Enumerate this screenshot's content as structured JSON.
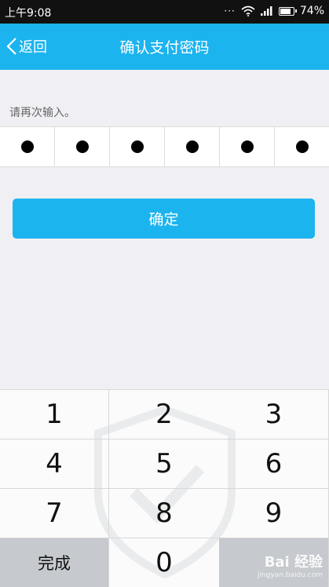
{
  "status_bar": {
    "time": "上午9:08",
    "dots": "···",
    "battery_text": "74%",
    "battery_level": 0.74
  },
  "nav": {
    "back_label": "返回",
    "title": "确认支付密码"
  },
  "hint": "请再次输入。",
  "pin": {
    "filled_count": 6
  },
  "confirm_label": "确定",
  "keypad": {
    "keys": [
      "1",
      "2",
      "3",
      "4",
      "5",
      "6",
      "7",
      "8",
      "9",
      "完成",
      "0",
      ""
    ]
  },
  "watermark": {
    "brand": "Bai 经验",
    "url": "jingyan.baidu.com"
  },
  "colors": {
    "accent": "#1cb4ef",
    "background": "#efeff4",
    "status_bar": "#111111",
    "done_key": "#c6c9ce"
  }
}
